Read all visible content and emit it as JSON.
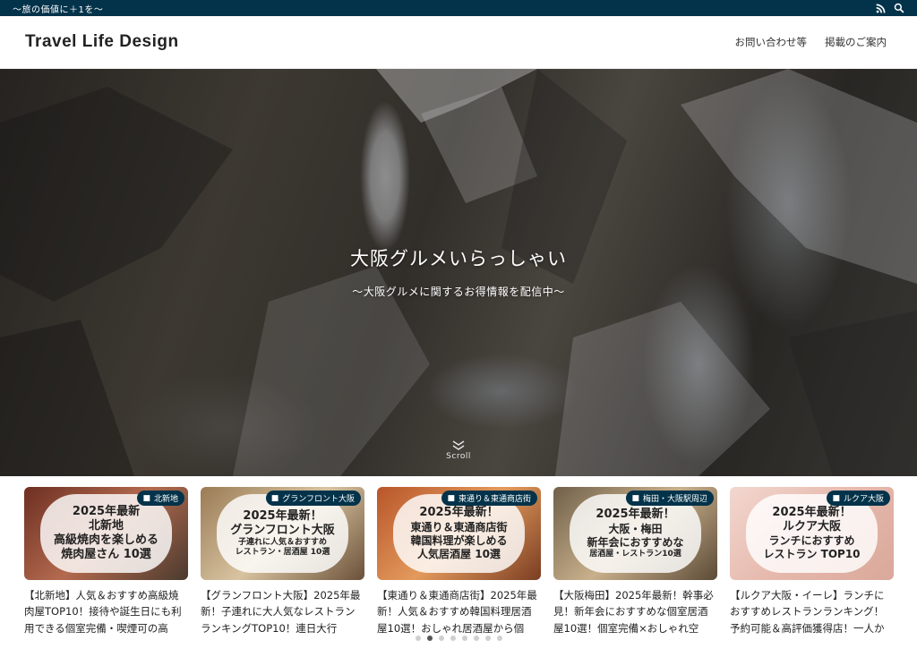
{
  "topbar": {
    "tagline": "〜旅の価値に＋1を〜"
  },
  "header": {
    "logo": "Travel Life Design",
    "nav": [
      {
        "label": "お問い合わせ等"
      },
      {
        "label": "掲載のご案内"
      }
    ]
  },
  "hero": {
    "title": "大阪グルメいらっしゃい",
    "subtitle": "〜大阪グルメに関するお得情報を配信中〜",
    "scroll_label": "Scroll"
  },
  "cards": [
    {
      "category": "北新地",
      "thumb_lines": [
        "2025年最新",
        "北新地",
        "高級焼肉を楽しめる",
        "焼肉屋さん 10選"
      ],
      "title": "【北新地】人気＆おすすめ高級焼肉屋TOP10！接待や誕生日にも利用できる個室完備・喫煙可の高",
      "bg": "#7a3a2c"
    },
    {
      "category": "グランフロント大阪",
      "thumb_lines": [
        "2025年最新！",
        "グランフロント大阪",
        "子連れに人気＆おすすめ",
        "レストラン・居酒屋 10選"
      ],
      "title": "【グランフロント大阪】2025年最新！子連れに大人気なレストランランキングTOP10！連日大行",
      "bg": "#8a6a48"
    },
    {
      "category": "東通り＆東通商店街",
      "thumb_lines": [
        "2025年最新！",
        "東通り＆東通商店街",
        "韓国料理が楽しめる",
        "人気居酒屋 10選"
      ],
      "title": "【東通り＆東通商店街】2025年最新！人気＆おすすめ韓国料理居酒屋10選！おしゃれ居酒屋から個",
      "bg": "#a8552e"
    },
    {
      "category": "梅田・大阪駅周辺",
      "thumb_lines": [
        "2025年最新！",
        "大阪・梅田",
        "新年会におすすめな",
        "居酒屋・レストラン10選"
      ],
      "title": "【大阪梅田】2025年最新！幹事必見！新年会におすすめな個室居酒屋10選！個室完備×おしゃれ空",
      "bg": "#7d6a52"
    },
    {
      "category": "ルクア大阪",
      "thumb_lines": [
        "2025年最新！",
        "ルクア大阪",
        "ランチにおすすめ",
        "レストラン TOP10"
      ],
      "title": "【ルクア大阪・イーレ】ランチにおすすめレストランランキング！予約可能＆高評価獲得店！一人か",
      "bg": "#e9c8bf"
    }
  ],
  "pagination": {
    "count": 8,
    "active_index": 1
  },
  "colors": {
    "brand": "#03334a"
  }
}
